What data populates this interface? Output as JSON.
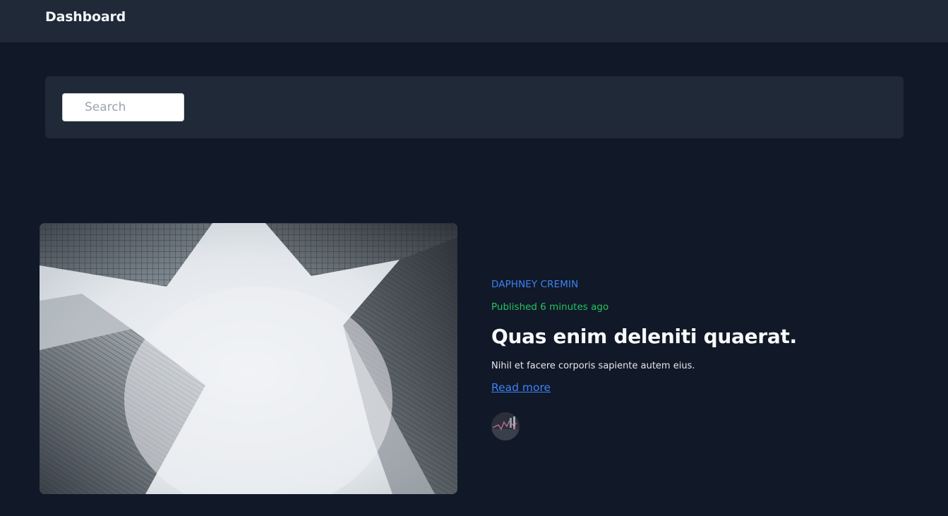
{
  "header": {
    "title": "Dashboard"
  },
  "search": {
    "placeholder": "Search",
    "icon": "search-icon"
  },
  "article": {
    "author": "DAPHNEY CREMIN",
    "published": "Published 6 minutes ago",
    "title": "Quas enim deleniti quaerat.",
    "excerpt": "Nihil et facere corporis sapiente autem eius.",
    "read_more_label": "Read more",
    "image": "photo looking up at skyscrapers in fog",
    "avatar": "author avatar"
  },
  "colors": {
    "background": "#111827",
    "panel": "#1f2937",
    "link": "#3b82f6",
    "published": "#22c55e",
    "text": "#f9fafb"
  }
}
